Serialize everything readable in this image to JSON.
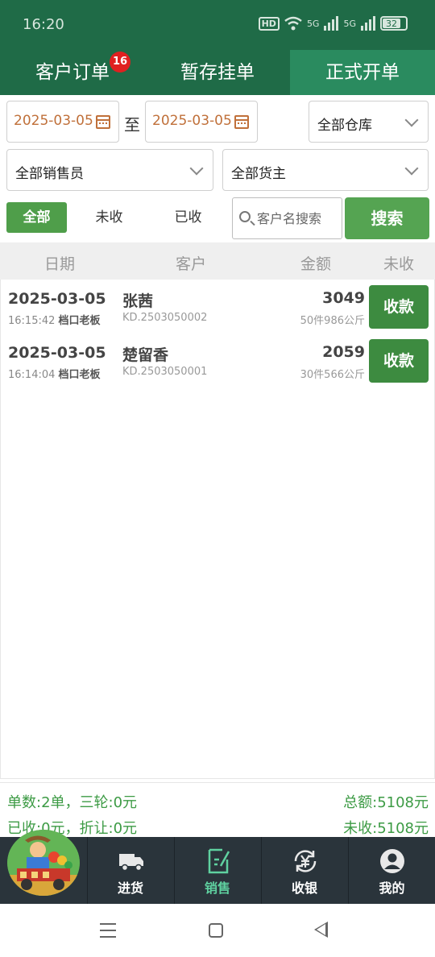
{
  "status_bar": {
    "time": "16:20",
    "hd_label": "HD",
    "net_label_1": "5G",
    "net_label_2": "5G",
    "battery": "32"
  },
  "tabs": [
    {
      "label": "客户订单",
      "badge": "16"
    },
    {
      "label": "暂存挂单"
    },
    {
      "label": "正式开单"
    }
  ],
  "filters": {
    "start_date": "2025-03-05",
    "range_sep": "至",
    "end_date": "2025-03-05",
    "warehouse": "全部仓库",
    "salesperson": "全部销售员",
    "owner": "全部货主"
  },
  "status_filter": {
    "all": "全部",
    "unpaid": "未收",
    "paid": "已收"
  },
  "search": {
    "placeholder": "客户名搜索",
    "button": "搜索"
  },
  "list_header": {
    "date": "日期",
    "customer": "客户",
    "amount": "金额",
    "unpaid": "未收"
  },
  "orders": [
    {
      "date": "2025-03-05",
      "time": "16:15:42",
      "operator": "档口老板",
      "customer": "张茜",
      "order_no": "KD.2503050002",
      "amount": "3049",
      "meta": "50件986公斤",
      "action": "收款"
    },
    {
      "date": "2025-03-05",
      "time": "16:14:04",
      "operator": "档口老板",
      "customer": "楚留香",
      "order_no": "KD.2503050001",
      "amount": "2059",
      "meta": "30件566公斤",
      "action": "收款"
    }
  ],
  "summary": {
    "count_line": "单数:2单，三轮:0元",
    "total": "总额:5108元",
    "paid_line": "已收:0元，折让:0元",
    "unpaid": "未收:5108元"
  },
  "bottom_nav": [
    {
      "label": "进货",
      "icon": "truck-icon"
    },
    {
      "label": "销售",
      "icon": "edit-icon"
    },
    {
      "label": "收银",
      "icon": "yen-refresh-icon"
    },
    {
      "label": "我的",
      "icon": "user-icon"
    }
  ],
  "colors": {
    "primary": "#1f6b47",
    "active_tab": "#2a8b5f",
    "accent_green": "#55a452",
    "badge_red": "#e02020",
    "date_orange": "#c0703a",
    "nav_bg": "#2a343b"
  }
}
